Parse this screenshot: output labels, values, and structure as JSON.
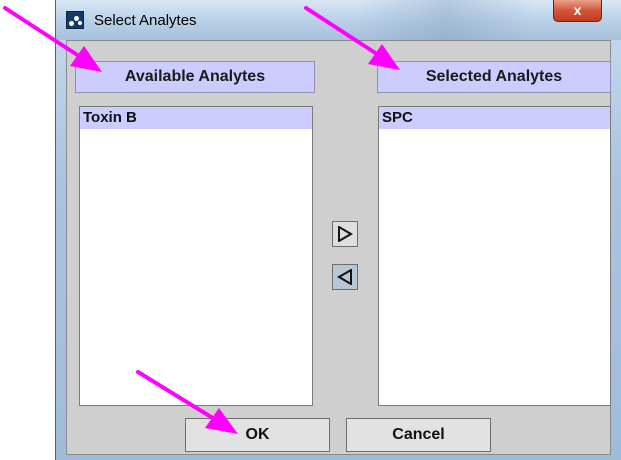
{
  "window": {
    "title": "Select Analytes",
    "close_label": "x"
  },
  "available": {
    "header": "Available Analytes",
    "items": [
      "Toxin B"
    ]
  },
  "selected": {
    "header": "Selected Analytes",
    "items": [
      "SPC"
    ]
  },
  "buttons": {
    "ok_label": "OK",
    "cancel_label": "Cancel"
  },
  "icons": {
    "add": "arrow-right-icon",
    "remove": "arrow-left-icon"
  },
  "colors": {
    "header_bg": "#ccccff",
    "selection_bg": "#ccccff",
    "annotation_arrow": "#ff00ff"
  }
}
